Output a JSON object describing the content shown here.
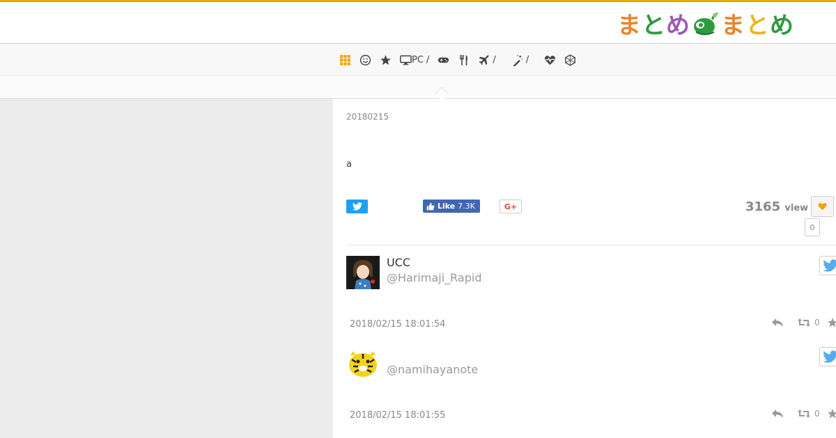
{
  "colors": {
    "accent": "#f0a500",
    "twitter": "#1da1f2",
    "facebook": "#4267b2",
    "google_plus": "#dd4b39",
    "heart": "#f0a500"
  },
  "logo": {
    "chars": [
      "ま",
      "と",
      "め",
      "ま",
      "と",
      "め"
    ]
  },
  "nav": {
    "items": [
      {
        "icon": "grid-icon",
        "slash": ""
      },
      {
        "icon": "smile-icon",
        "slash": ""
      },
      {
        "icon": "star-icon",
        "slash": ""
      },
      {
        "icon": "desktop-icon",
        "label": "PC",
        "slash": "/"
      },
      {
        "icon": "gamepad-icon",
        "slash": ""
      },
      {
        "icon": "utensils-icon",
        "slash": ""
      },
      {
        "icon": "plane-icon",
        "slash": "/"
      },
      {
        "icon": "magic-wand-icon",
        "slash": "/"
      },
      {
        "icon": "heartbeat-icon",
        "slash": ""
      },
      {
        "icon": "hexagon-icon",
        "slash": ""
      }
    ]
  },
  "article": {
    "date": "20180215",
    "body": "a",
    "share": {
      "facebook_label": "Like",
      "facebook_count": "7.3K",
      "google_label": "G+"
    },
    "views": "3165",
    "views_unit": "view",
    "favorites": "0"
  },
  "tweets": [
    {
      "name": "UCC",
      "handle": "@Harimaji_Rapid",
      "timestamp": "2018/02/15 18:01:54",
      "retweets": "0",
      "avatar": "anime-avatar"
    },
    {
      "name": "",
      "handle": "@namihayanote",
      "timestamp": "2018/02/15 18:01:55",
      "retweets": "0",
      "avatar": "tiger-avatar"
    }
  ]
}
